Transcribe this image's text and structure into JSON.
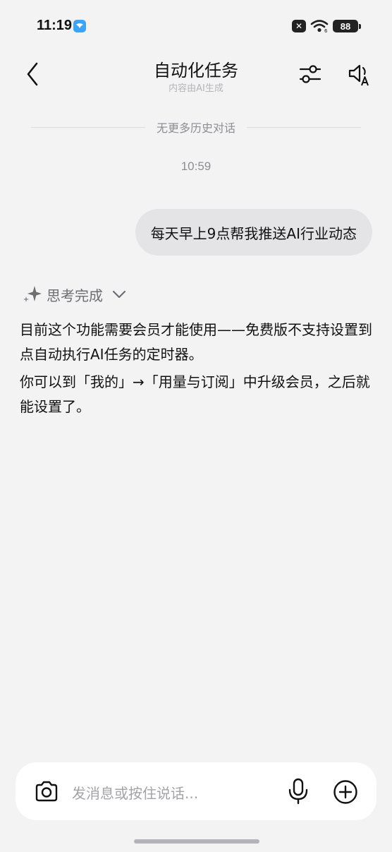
{
  "status_bar": {
    "time": "11:19",
    "app_icon": "bird-app-icon",
    "close_badge": "✕",
    "battery": "88"
  },
  "header": {
    "title": "自动化任务",
    "subtitle": "内容由AI生成",
    "back_icon": "chevron-left-icon",
    "settings_icon": "sliders-icon",
    "voice_icon": "speaker-a-icon"
  },
  "chat": {
    "history_divider": "无更多历史对话",
    "timestamp": "10:59",
    "user_message": "每天早上9点帮我推送AI行业动态",
    "thinking_label": "思考完成",
    "answer_paragraphs": [
      "目前这个功能需要会员才能使用——免费版不支持设置到点自动执行AI任务的定时器。",
      "你可以到「我的」→「用量与订阅」中升级会员，之后就能设置了。"
    ]
  },
  "input_bar": {
    "placeholder": "发消息或按住说话...",
    "camera_icon": "camera-icon",
    "mic_icon": "microphone-icon",
    "plus_icon": "plus-circle-icon"
  },
  "colors": {
    "background": "#f3f3f4",
    "user_bubble": "#e4e4e7",
    "input_bg": "#ffffff"
  }
}
